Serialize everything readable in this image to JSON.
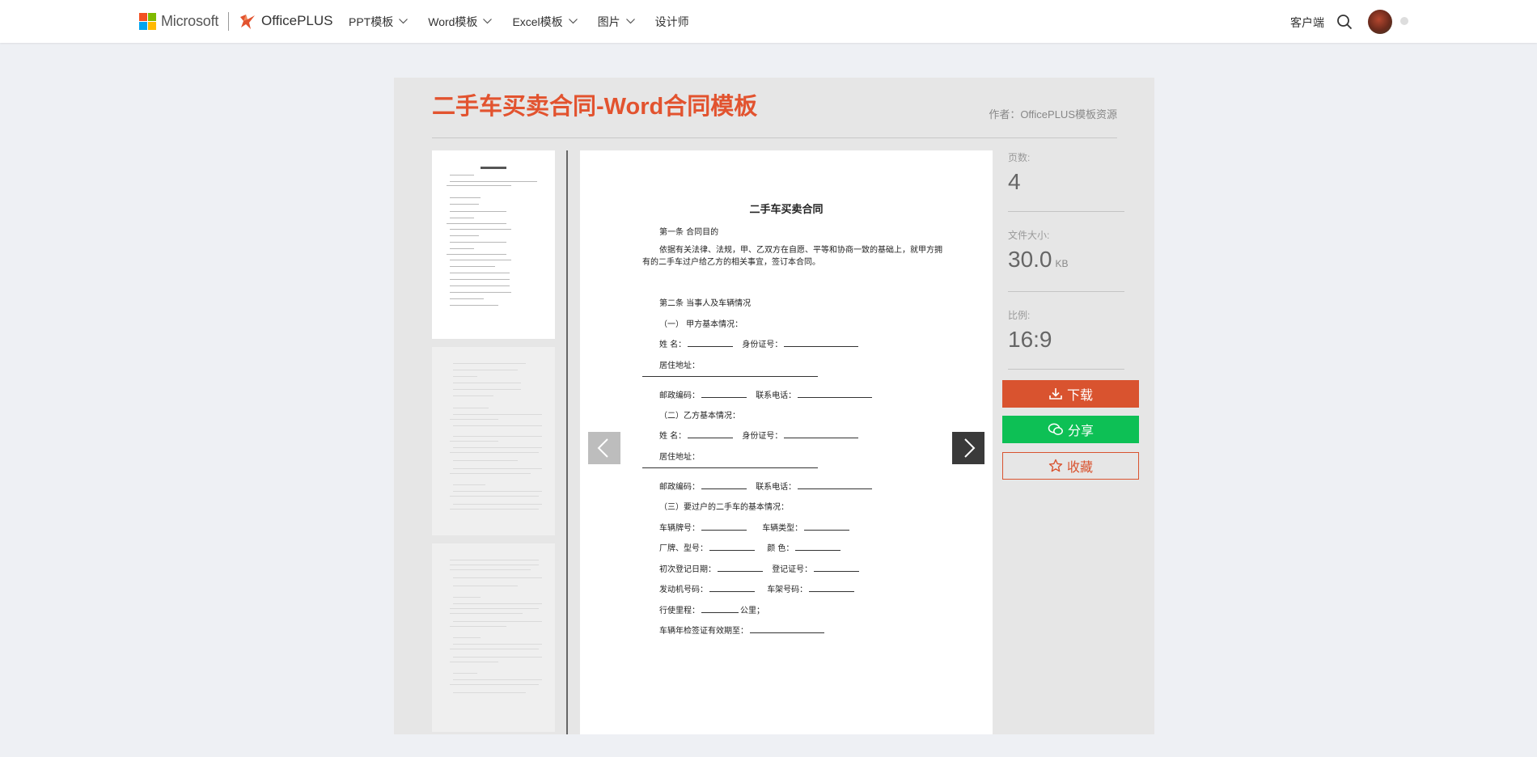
{
  "topbar": {
    "brand": "Microsoft",
    "product": "OfficePLUS",
    "nav": [
      {
        "label": "PPT模板",
        "has_dropdown": true
      },
      {
        "label": "Word模板",
        "has_dropdown": true
      },
      {
        "label": "Excel模板",
        "has_dropdown": true
      },
      {
        "label": "图片",
        "has_dropdown": true
      },
      {
        "label": "设计师",
        "has_dropdown": false
      }
    ],
    "client_link": "客户端",
    "icons": [
      "microsoft-logo",
      "officeplus-logo",
      "chevron-down-icon",
      "search-icon",
      "avatar"
    ]
  },
  "detail": {
    "title": "二手车买卖合同-Word合同模板",
    "author": "作者：OfficePLUS模板资源",
    "title_color": "#e2532f"
  },
  "preview": {
    "doc_title": "二手车买卖合同",
    "lines": {
      "s1": "第一条  合同目的",
      "p1": "依据有关法律、法规，甲、乙双方在自愿、平等和协商一致的基础上，就甲方拥有的二手车过户给乙方的相关事宜，签订本合同。",
      "s2": "第二条  当事人及车辆情况",
      "a_head": "（一）  甲方基本情况：",
      "name": "姓      名：",
      "id_no": "身份证号：",
      "address": "居住地址：",
      "postcode": "邮政编码：",
      "phone": "联系电话：",
      "b_head": "（二）乙方基本情况：",
      "c_head": "（三）要过户的二手车的基本情况：",
      "plate": "车辆牌号：",
      "car_type": "车辆类型：",
      "brand_model": "厂牌、型号：",
      "color": "颜      色：",
      "first_reg": "初次登记日期：",
      "reg_cert": "登记证号：",
      "engine_no": "发动机号码：",
      "frame_no": "车架号码：",
      "mileage": "行使里程：",
      "mileage_unit": "公里；",
      "inspection": "车辆年检签证有效期至："
    },
    "prev_icon": "chevron-left-icon",
    "next_icon": "chevron-right-icon",
    "thumbnail_count": 3
  },
  "info": {
    "pages_label": "页数:",
    "pages_value": "4",
    "size_label": "文件大小:",
    "size_value": "30.0",
    "size_unit": "KB",
    "ratio_label": "比例:",
    "ratio_value": "16:9"
  },
  "actions": {
    "download": "下载",
    "share": "分享",
    "favorite": "收藏",
    "download_color": "#d9532f",
    "share_color": "#0dc055",
    "icons": [
      "download-icon",
      "wechat-icon",
      "star-icon"
    ]
  }
}
